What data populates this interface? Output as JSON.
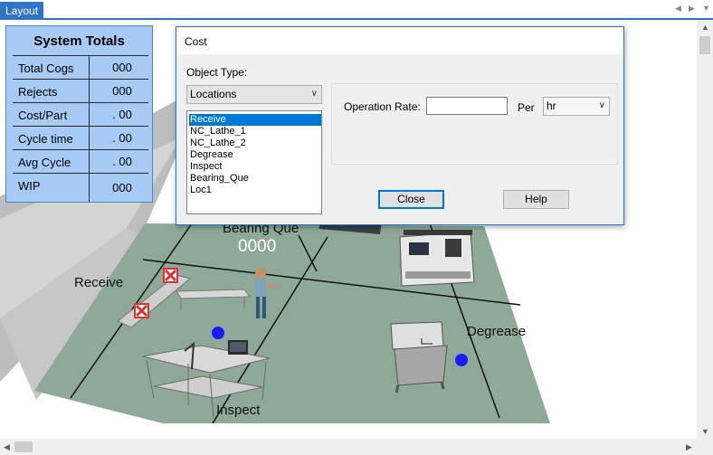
{
  "tab": {
    "label": "Layout"
  },
  "totals": {
    "title": "System Totals",
    "rows": [
      {
        "label": "Total Cogs",
        "value": "000"
      },
      {
        "label": "Rejects",
        "value": "000"
      },
      {
        "label": "Cost/Part",
        "value": ". 00"
      },
      {
        "label": "Cycle time",
        "value": ". 00"
      },
      {
        "label": "Avg Cycle",
        "value": ". 00"
      },
      {
        "label": "WIP",
        "value": "000"
      }
    ]
  },
  "scene": {
    "labels": {
      "receive": "Receive",
      "bearing_que": "Bearing Que",
      "degrease": "Degrease",
      "inspect": "Inspect"
    },
    "counter": "0000",
    "colors": {
      "floor": "#8fa896",
      "wall": "#b9b9b9",
      "marker_blue": "#1a1aff",
      "reject_red": "#e23030"
    }
  },
  "dialog": {
    "title": "Cost",
    "object_type_label": "Object Type:",
    "object_type_value": "Locations",
    "items": [
      "Receive",
      "NC_Lathe_1",
      "NC_Lathe_2",
      "Degrease",
      "Inspect",
      "Bearing_Que",
      "Loc1"
    ],
    "selected_index": 0,
    "operation_rate_label": "Operation Rate:",
    "operation_rate_value": "",
    "per_label": "Per",
    "per_value": "hr",
    "close_label": "Close",
    "help_label": "Help"
  }
}
